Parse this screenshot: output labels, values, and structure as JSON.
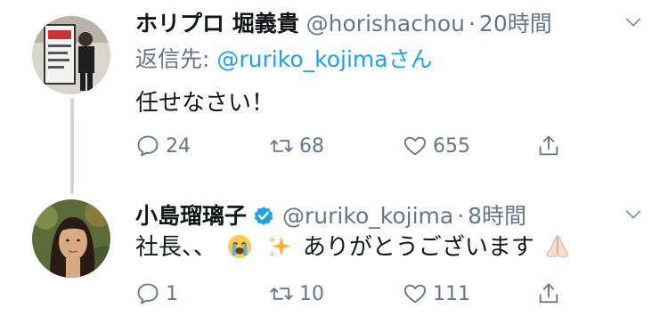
{
  "tweets": [
    {
      "display_name": "ホリプロ 堀義貴",
      "handle": "@horishachou",
      "time": "20時間",
      "reply_label": "返信先:",
      "reply_target": "@ruriko_kojimaさん",
      "text": "任せなさい！",
      "reply_count": "24",
      "retweet_count": "68",
      "like_count": "655",
      "verified": false
    },
    {
      "display_name": "小島瑠璃子",
      "handle": "@ruriko_kojima",
      "time": "8時間",
      "text_prefix": "社長、、",
      "text_suffix": "ありがとうございます",
      "reply_count": "1",
      "retweet_count": "10",
      "like_count": "111",
      "verified": true
    }
  ],
  "dot": "·",
  "colors": {
    "link_blue": "#1da1f2",
    "muted": "#657786",
    "text": "#14171a",
    "thread_line": "#ccd6dd"
  },
  "icons": [
    "reply-icon",
    "retweet-icon",
    "like-icon",
    "share-icon",
    "chevron-down-icon",
    "verified-badge-icon",
    "crying-face-emoji",
    "sparkles-emoji",
    "folded-hands-emoji"
  ]
}
